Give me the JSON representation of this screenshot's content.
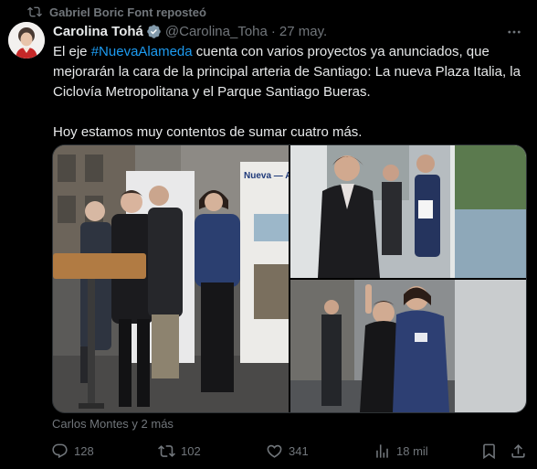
{
  "repost": {
    "icon": "repost-icon",
    "text": "Gabriel Boric Font reposteó"
  },
  "author": {
    "name": "Carolina Tohá",
    "verified_icon": "verified-badge-icon",
    "handle": "@Carolina_Toha",
    "separator": "·",
    "date": "27 may."
  },
  "tweet": {
    "line1_before": "El eje ",
    "hashtag": "#NuevaAlameda",
    "line1_after": " cuenta con varios proyectos ya anunciados, que mejorarán la cara de la principal arteria de Santiago: La nueva Plaza Italia, la Ciclovía Metropolitana y el Parque Santiago Bueras.",
    "paragraph2": "Hoy estamos muy contentos de sumar cuatro más."
  },
  "media": {
    "photo1": {
      "sign": "Nueva — Ala"
    },
    "photo2": {},
    "photo3": {}
  },
  "tagged": "Carlos Montes y 2 más",
  "actions": {
    "reply_count": "128",
    "repost_count": "102",
    "like_count": "341",
    "views_count": "18 mil"
  },
  "colors": {
    "background": "#000000",
    "text": "#e7e9ea",
    "secondary": "#71767b",
    "link": "#1d9bf0"
  }
}
